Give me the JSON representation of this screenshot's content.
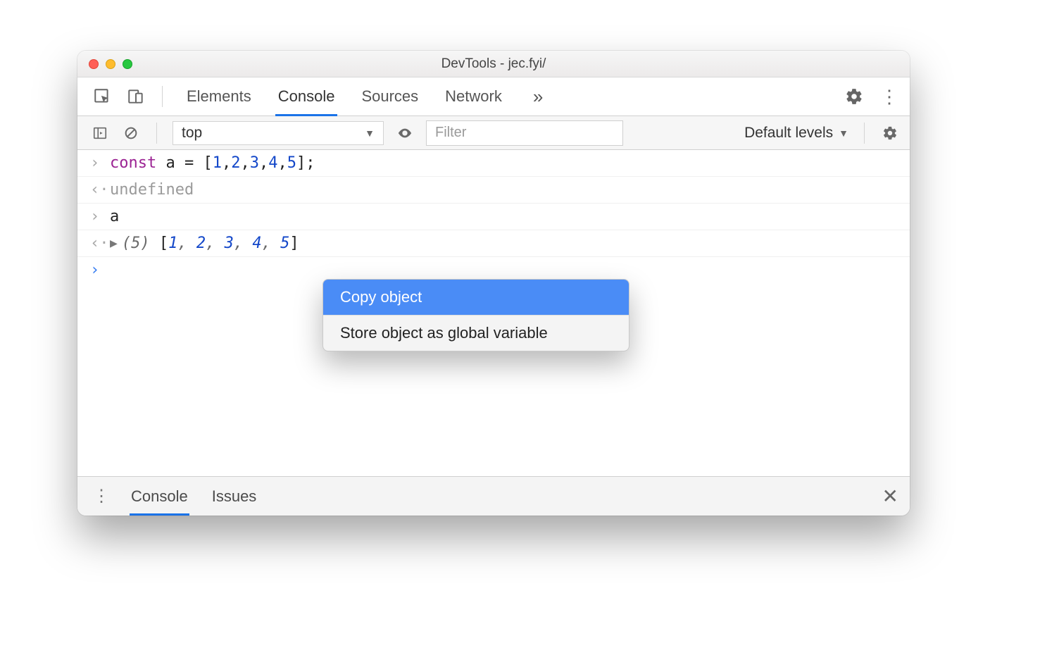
{
  "window": {
    "title": "DevTools - jec.fyi/"
  },
  "tabs": {
    "elements": "Elements",
    "console": "Console",
    "sources": "Sources",
    "network": "Network"
  },
  "filterbar": {
    "context": "top",
    "filter_placeholder": "Filter",
    "levels_label": "Default levels"
  },
  "console": {
    "line1": {
      "kw": "const",
      "var": "a",
      "eq": " = [",
      "n1": "1",
      "n2": "2",
      "n3": "3",
      "n4": "4",
      "n5": "5",
      "close": "];"
    },
    "line2": "undefined",
    "line3": "a",
    "line4": {
      "len": "(5)",
      "open": " [",
      "v1": "1",
      "v2": "2",
      "v3": "3",
      "v4": "4",
      "v5": "5",
      "close": "]"
    }
  },
  "context_menu": {
    "copy": "Copy object",
    "store": "Store object as global variable"
  },
  "drawer": {
    "console": "Console",
    "issues": "Issues"
  }
}
